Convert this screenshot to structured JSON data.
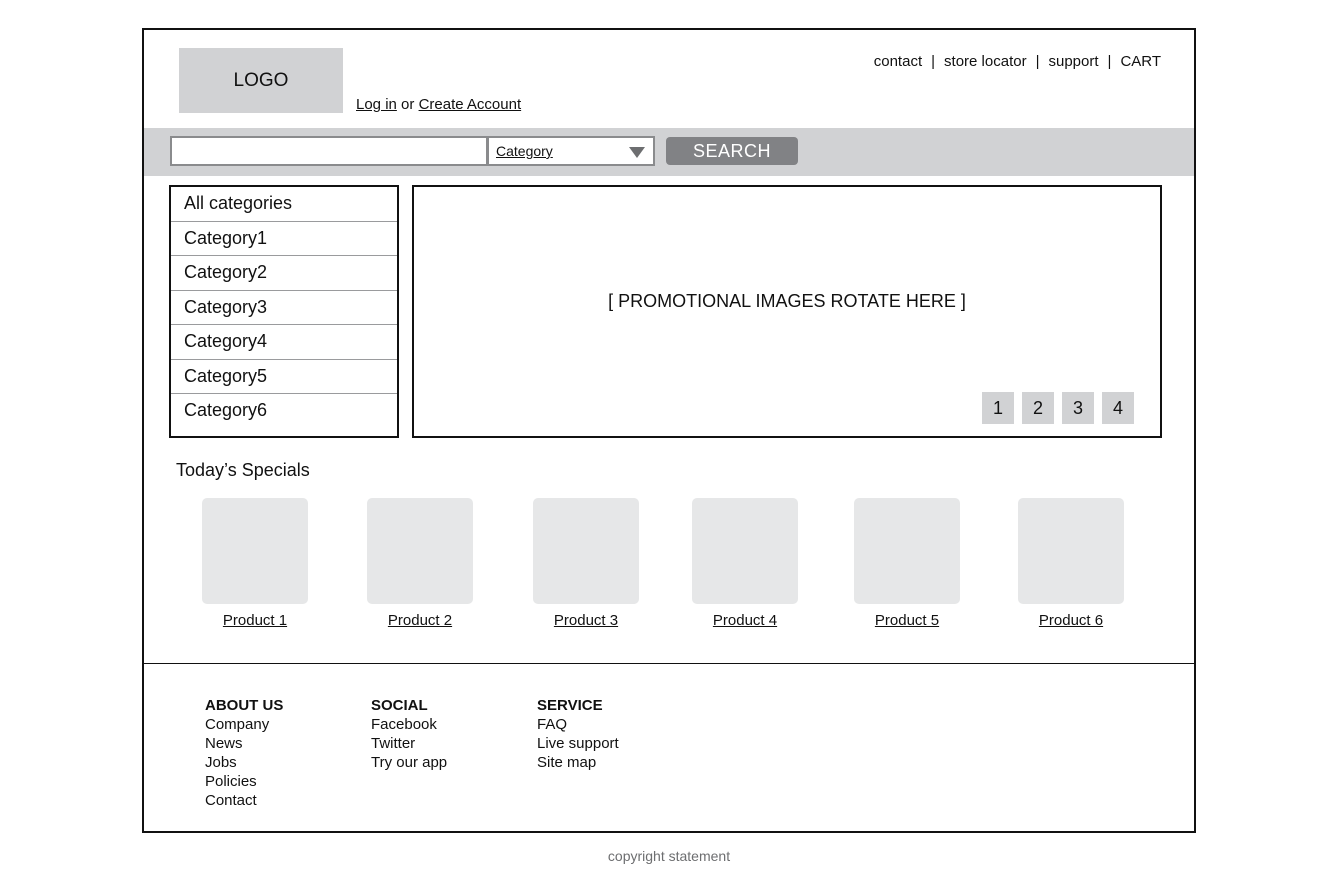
{
  "header": {
    "logo": "LOGO",
    "login": "Log in",
    "or": "or",
    "create_account": "Create Account",
    "nav": [
      "contact",
      "store locator",
      "support",
      "CART"
    ],
    "separator": "|"
  },
  "search": {
    "placeholder": "",
    "category_label": "Category",
    "button": "SEARCH"
  },
  "categories": [
    "All categories",
    "Category1",
    "Category2",
    "Category3",
    "Category4",
    "Category5",
    "Category6"
  ],
  "promo": {
    "text": "[ PROMOTIONAL IMAGES ROTATE HERE ]",
    "pages": [
      "1",
      "2",
      "3",
      "4"
    ]
  },
  "specials": {
    "title": "Today’s Specials",
    "products": [
      "Product 1",
      "Product 2",
      "Product 3",
      "Product 4",
      "Product 5",
      "Product 6"
    ]
  },
  "footer": {
    "columns": [
      {
        "heading": "ABOUT US",
        "links": [
          "Company",
          "News",
          "Jobs",
          "Policies",
          "Contact"
        ]
      },
      {
        "heading": "SOCIAL",
        "links": [
          "Facebook",
          "Twitter",
          "Try our app"
        ]
      },
      {
        "heading": "SERVICE",
        "links": [
          "FAQ",
          "Live support",
          "Site map"
        ]
      }
    ],
    "copyright": "copyright statement"
  },
  "colors": {
    "gray_bar": "#d1d2d4",
    "button": "#818285",
    "thumb": "#e6e7e8"
  }
}
